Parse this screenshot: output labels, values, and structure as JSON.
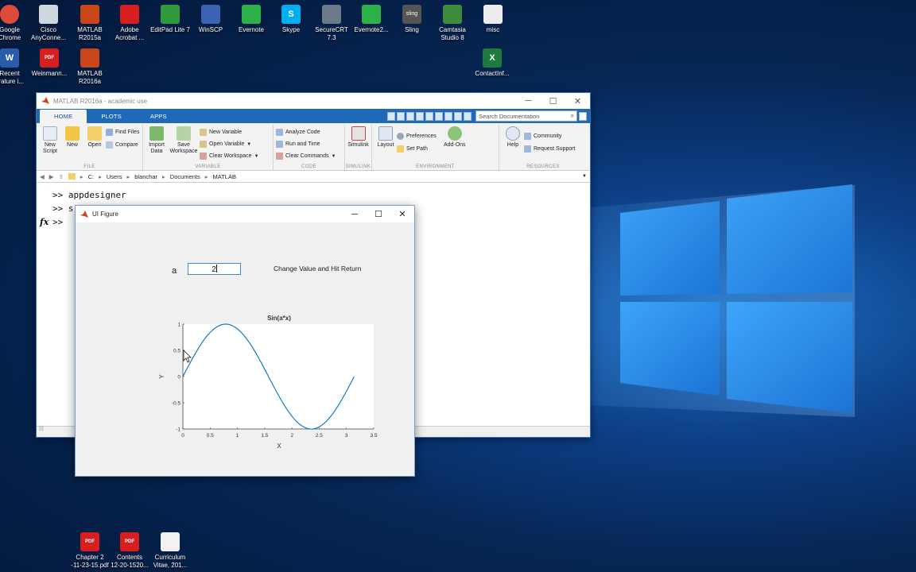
{
  "desktop": {
    "icons": [
      {
        "label": "Google\nChrome",
        "glyph": "",
        "color": "#dd4b39"
      },
      {
        "label": "Cisco\nAnyConne...",
        "glyph": "",
        "color": "#cfd8e0"
      },
      {
        "label": "MATLAB\nR2015a",
        "glyph": "",
        "color": "#c9461a"
      },
      {
        "label": "Adobe\nAcrobat ...",
        "glyph": "",
        "color": "#d81f1f"
      },
      {
        "label": "EditPad Lite 7",
        "glyph": "",
        "color": "#2f9a3b"
      },
      {
        "label": "WinSCP",
        "glyph": "",
        "color": "#3a62b5"
      },
      {
        "label": "Evernote",
        "glyph": "",
        "color": "#2db24a"
      },
      {
        "label": "Skype",
        "glyph": "S",
        "color": "#00aff0"
      },
      {
        "label": "SecureCRT\n7.3",
        "glyph": "",
        "color": "#6c7a8a"
      },
      {
        "label": "Evernote2...",
        "glyph": "",
        "color": "#2db24a"
      },
      {
        "label": "Sling",
        "glyph": "sling",
        "color": "#555"
      },
      {
        "label": "Camtasia\nStudio 8",
        "glyph": "",
        "color": "#3d8b3d"
      },
      {
        "label": "misc",
        "glyph": "",
        "color": "#ececec"
      },
      {
        "label": "Recent\nerature i...",
        "glyph": "W",
        "color": "#2a5caa"
      },
      {
        "label": "Weinmann...",
        "glyph": "PDF",
        "color": "#d81f1f"
      },
      {
        "label": "MATLAB\nR2016a",
        "glyph": "",
        "color": "#c9461a"
      },
      {
        "label": "ContactInf...",
        "glyph": "X",
        "color": "#1f7a3f"
      },
      {
        "label": "Chapter 2\n-11-23-15.pdf",
        "glyph": "PDF",
        "color": "#d81f1f"
      },
      {
        "label": "Contents\n12-20-1520...",
        "glyph": "PDF",
        "color": "#d81f1f"
      },
      {
        "label": "Curriculum\nVitae, 201...",
        "glyph": "",
        "color": "#f2f2f2"
      }
    ]
  },
  "matlab": {
    "title": "MATLAB R2016a - academic use",
    "tabs": [
      "HOME",
      "PLOTS",
      "APPS"
    ],
    "search_placeholder": "Search Documentation",
    "ribbon": {
      "new_script": "New\nScript",
      "new": "New",
      "open": "Open",
      "find_files": "Find Files",
      "compare": "Compare",
      "import_data": "Import\nData",
      "save_workspace": "Save\nWorkspace",
      "new_variable": "New Variable",
      "open_variable": "Open Variable",
      "clear_workspace": "Clear Workspace",
      "analyze_code": "Analyze Code",
      "run_and_time": "Run and Time",
      "clear_commands": "Clear Commands",
      "simulink": "Simulink",
      "layout": "Layout",
      "preferences": "Preferences",
      "set_path": "Set Path",
      "add_ons": "Add-Ons",
      "help": "Help",
      "community": "Community",
      "request_support": "Request Support",
      "groups": {
        "file": "FILE",
        "variable": "VARIABLE",
        "code": "CODE",
        "simulink": "SIMULINK",
        "environment": "ENVIRONMENT",
        "resources": "RESOURCES"
      }
    },
    "path": [
      "C:",
      "Users",
      "blanchar",
      "Documents",
      "MATLAB"
    ],
    "command_window": {
      "line1": ">> appdesigner",
      "line2": ">> s",
      "line3": ">>",
      "fx": "fx"
    }
  },
  "uifigure": {
    "title": "UI Figure",
    "field_label": "a",
    "field_value": "2",
    "hint": "Change Value and Hit Return",
    "chart": {
      "title": "Sin(a*x)",
      "xlabel": "X",
      "ylabel": "Y"
    }
  },
  "chart_data": {
    "type": "line",
    "title": "Sin(a*x)",
    "xlabel": "X",
    "ylabel": "Y",
    "xlim": [
      0,
      3.5
    ],
    "ylim": [
      -1,
      1
    ],
    "xticks": [
      "0",
      "0.5",
      "1",
      "1.5",
      "2",
      "2.5",
      "3",
      "3.5"
    ],
    "yticks": [
      "1",
      "0.5",
      "0",
      "-0.5",
      "-1"
    ],
    "function": "sin(a*x)",
    "a": 2,
    "x_range": [
      0,
      3.14
    ],
    "series": [
      {
        "color": "#0072bd",
        "x": [
          0,
          0.25,
          0.5,
          0.785,
          1.0,
          1.25,
          1.5,
          1.75,
          2.0,
          2.25,
          2.356,
          2.5,
          2.75,
          3.0,
          3.14
        ],
        "y": [
          0,
          0.479,
          0.841,
          1.0,
          0.909,
          0.598,
          0.141,
          -0.351,
          -0.757,
          -0.978,
          -1.0,
          -0.959,
          -0.706,
          -0.279,
          -0.003
        ]
      }
    ]
  }
}
